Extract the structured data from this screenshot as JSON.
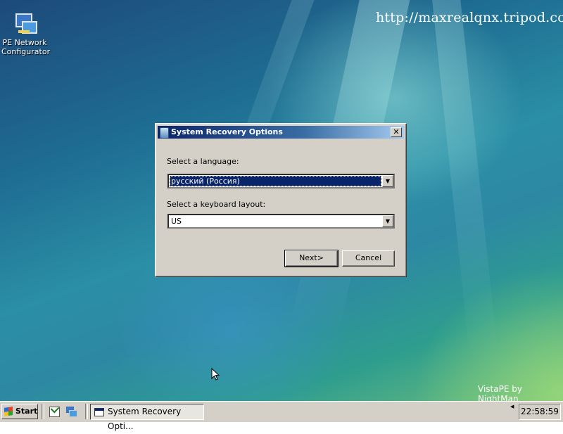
{
  "desktop": {
    "url_text": "http://maxrealqnx.tripod.com",
    "brand_text": "VistaPE by NightMan",
    "icons": [
      {
        "label_line1": "PE Network",
        "label_line2": "Configurator",
        "icon": "network-configurator-icon"
      }
    ]
  },
  "dialog": {
    "title": "System Recovery Options",
    "close_glyph": "✕",
    "language_label": "Select a language:",
    "language_value": "русский (Россия)",
    "keyboard_label": "Select a keyboard layout:",
    "keyboard_value": "US",
    "next_label": "Next>",
    "cancel_label": "Cancel"
  },
  "taskbar": {
    "start_label": "Start",
    "task_label": "System Recovery Opti...",
    "clock": "22:58:59"
  },
  "colors": {
    "titlebar_start": "#0a246a",
    "titlebar_end": "#a6caf0",
    "selection": "#0a246a",
    "chrome": "#d4d0c8"
  }
}
